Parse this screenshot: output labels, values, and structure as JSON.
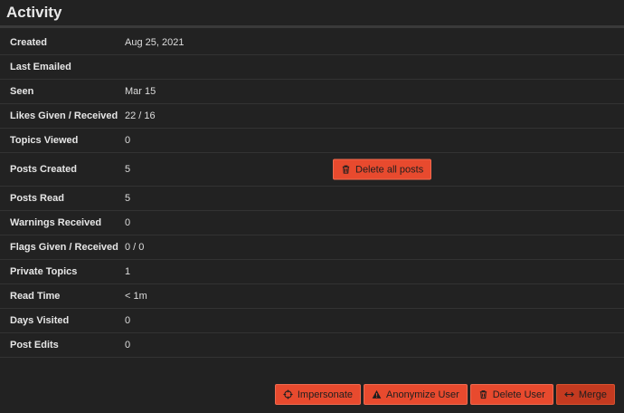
{
  "section": {
    "title": "Activity"
  },
  "rows": [
    {
      "label": "Created",
      "value": "Aug 25, 2021"
    },
    {
      "label": "Last Emailed",
      "value": ""
    },
    {
      "label": "Seen",
      "value": "Mar 15"
    },
    {
      "label": "Likes Given / Received",
      "value": "22 / 16"
    },
    {
      "label": "Topics Viewed",
      "value": "0"
    },
    {
      "label": "Posts Created",
      "value": "5"
    },
    {
      "label": "Posts Read",
      "value": "5"
    },
    {
      "label": "Warnings Received",
      "value": "0"
    },
    {
      "label": "Flags Given / Received",
      "value": "0 / 0"
    },
    {
      "label": "Private Topics",
      "value": "1"
    },
    {
      "label": "Read Time",
      "value": "< 1m"
    },
    {
      "label": "Days Visited",
      "value": "0"
    },
    {
      "label": "Post Edits",
      "value": "0"
    }
  ],
  "buttons": {
    "delete_all_posts": "Delete all posts",
    "impersonate": "Impersonate",
    "anonymize": "Anonymize User",
    "delete_user": "Delete User",
    "merge": "Merge"
  },
  "icons": {
    "trash": "trash-icon",
    "crosshair": "crosshair-icon",
    "warning": "warning-icon",
    "merge": "arrows-left-right-icon"
  },
  "colors": {
    "background": "#222222",
    "button": "#e84a2e",
    "button_dark": "#c43a20",
    "button_text": "#1e1e1e"
  }
}
